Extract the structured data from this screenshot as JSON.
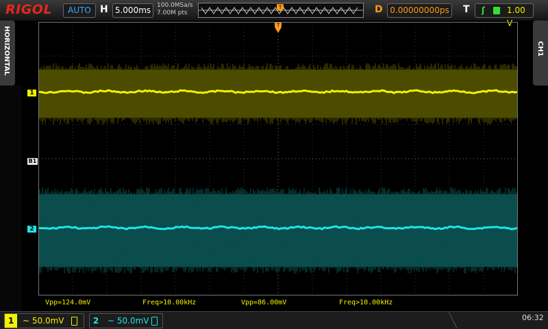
{
  "brand": "RIGOL",
  "acquisition": {
    "mode": "AUTO"
  },
  "horizontal": {
    "letter": "H",
    "timebase": "5.000ms",
    "sample_rate": "100.0MSa/s",
    "memory_depth": "7.00M pts"
  },
  "delay": {
    "letter": "D",
    "value": "0.00000000ps"
  },
  "trigger": {
    "letter": "T",
    "slope_icon": "rising-edge",
    "source_icon": "ch-source",
    "level": "1.00 V",
    "marker": "T"
  },
  "side_tabs": {
    "left": "HORIZONTAL",
    "right": "CH1"
  },
  "markers": {
    "ch1": "1",
    "ch2": "2",
    "ref": "B1"
  },
  "measurements": {
    "ch1_vpp": "Vpp=124.0mV",
    "ch1_freq": "Freq>10.00kHz",
    "ch2_vpp": "Vpp=86.00mV",
    "ch2_freq": "Freq>10.00kHz"
  },
  "channels": [
    {
      "number": "1",
      "coupling": "~",
      "scale": "50.0mV",
      "color": "#f2f200"
    },
    {
      "number": "2",
      "coupling": "~",
      "scale": "50.0mV",
      "color": "#1ee6e6"
    }
  ],
  "clock": "06:32",
  "colors": {
    "ch1": "#f2f200",
    "ch2": "#1ee6e6",
    "logo": "#e8261c",
    "trigger_pos": "#ff9a1a",
    "grid": "#555555"
  }
}
